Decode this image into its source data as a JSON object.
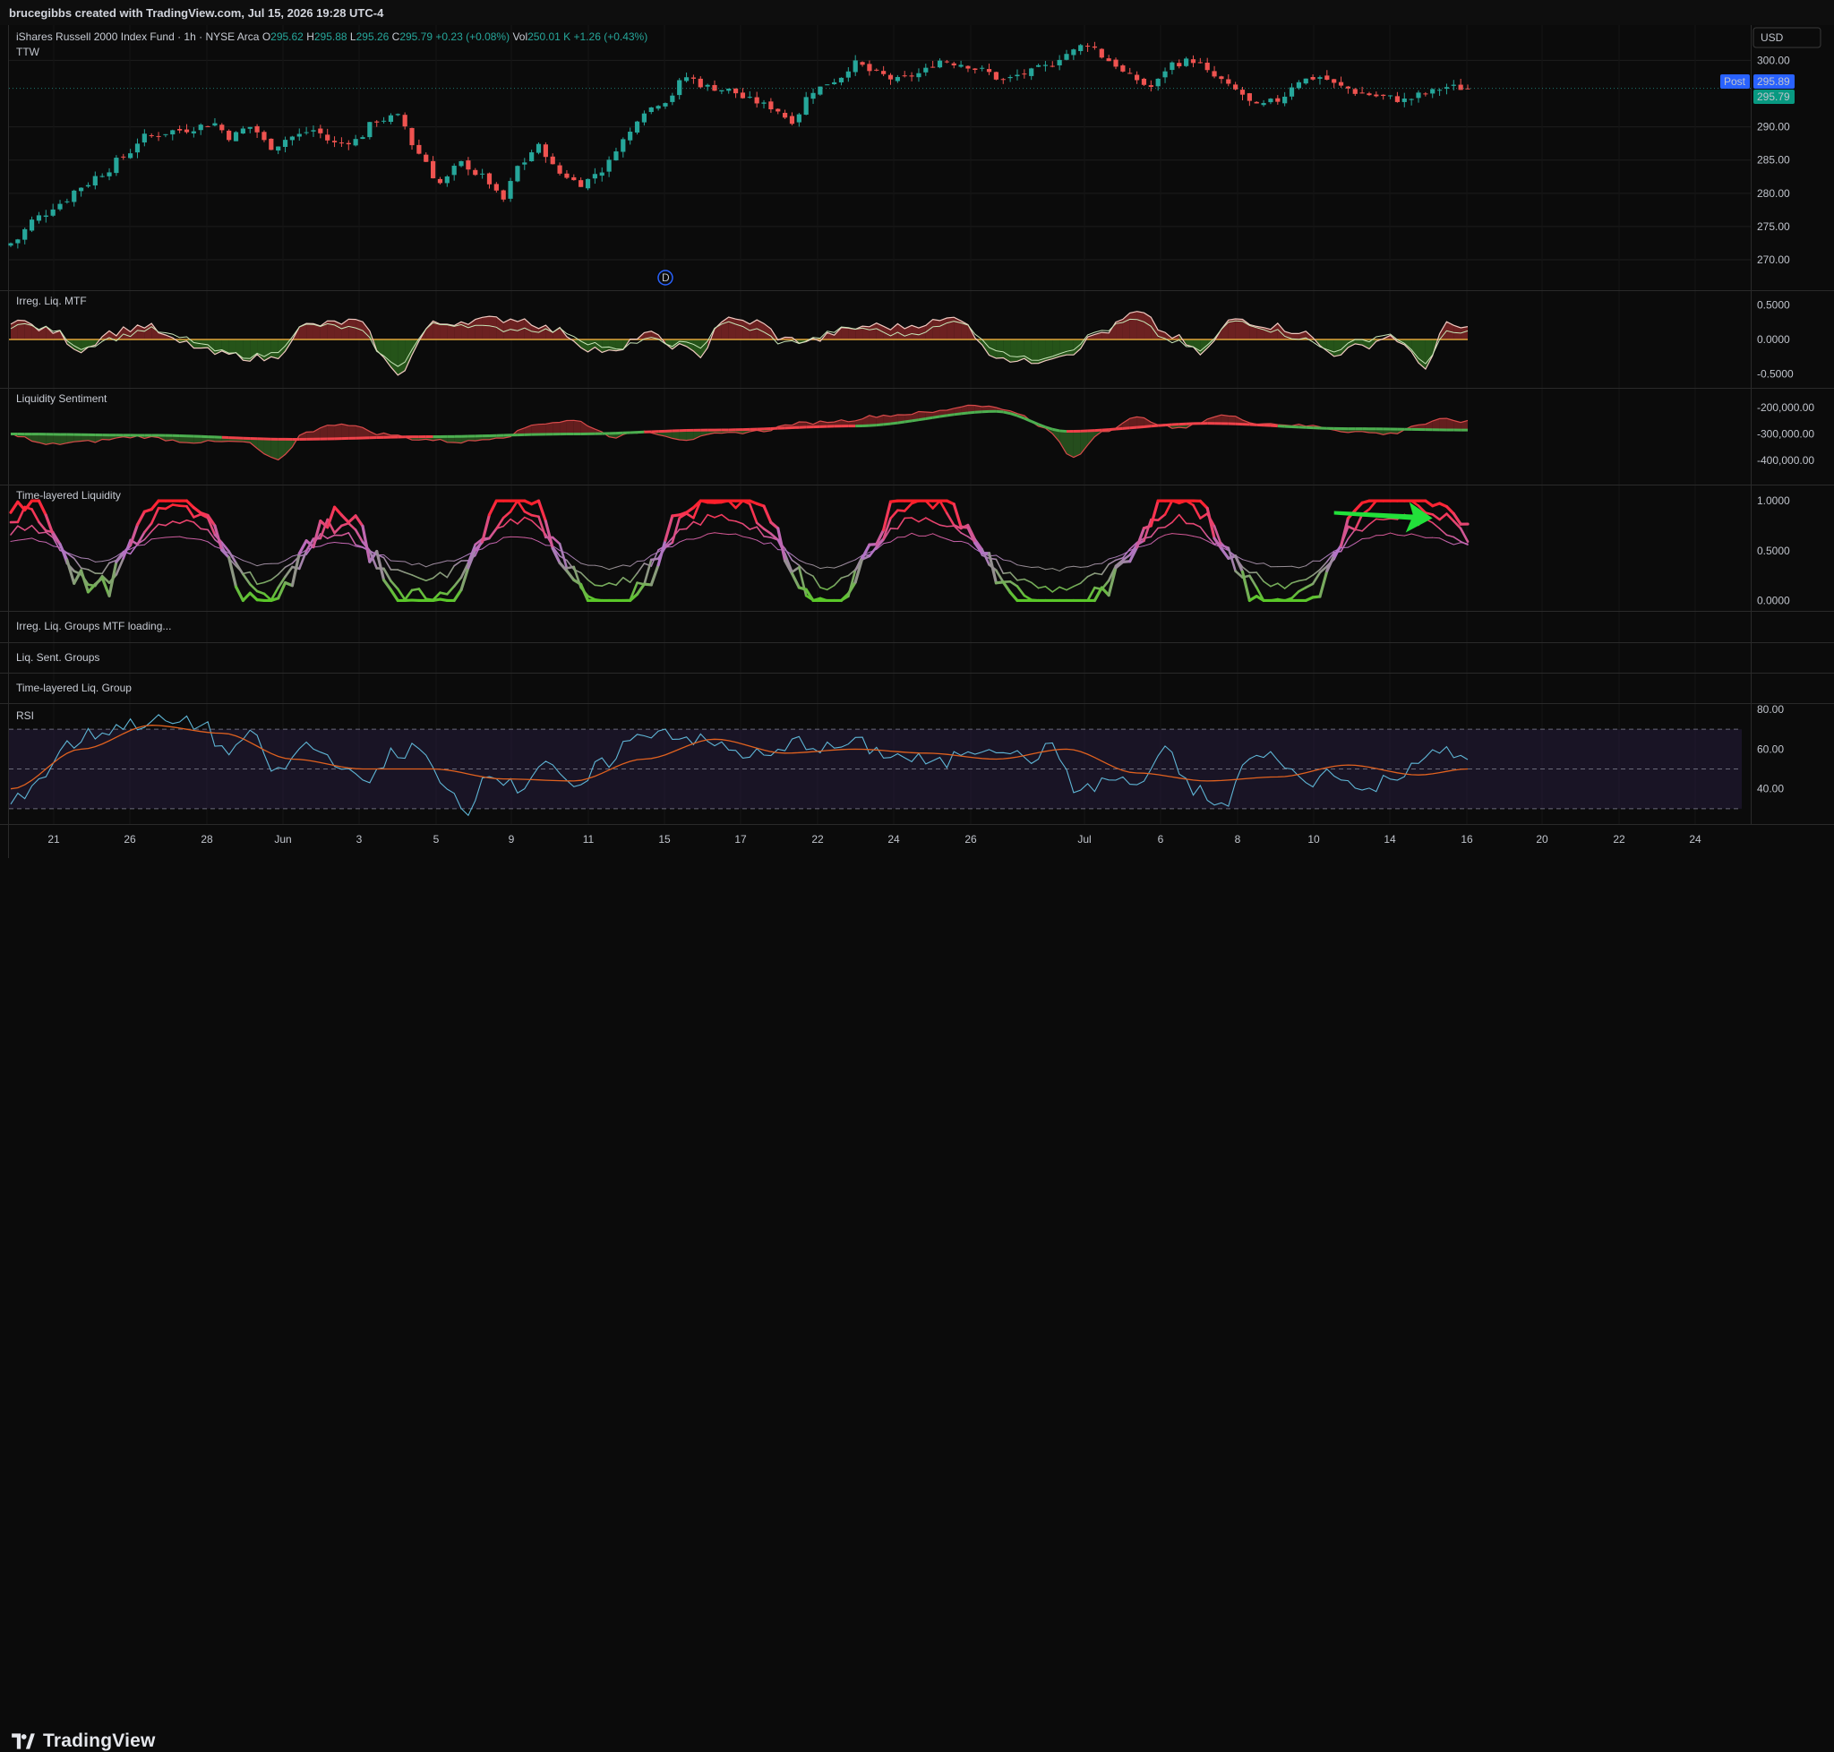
{
  "header": {
    "watermark": "brucegibbs created with TradingView.com, Jul 15, 2026 19:28 UTC-4"
  },
  "footer": {
    "brand": "TradingView"
  },
  "colors": {
    "up": "#26a69a",
    "down": "#ef5350",
    "bg": "#0b0b0b",
    "grid": "#1c1c1c",
    "post_badge": "#2962ff",
    "last_badge": "#089981",
    "rsi_line": "#5fb6d6",
    "rsi_ma": "#e0611f"
  },
  "chart_data": [
    {
      "type": "candlestick",
      "pane": "price",
      "symbol_title": "iShares Russell 2000 Index Fund · 1h · NYSE Arca",
      "symbol_sub": "TTW",
      "ohlc": {
        "O": "295.62",
        "H": "295.88",
        "L": "295.26",
        "C": "295.79",
        "change": "+0.23 (+0.08%)"
      },
      "volume": {
        "label": "Vol",
        "value": "250.01 K",
        "change": "+1.26 (+0.43%)"
      },
      "currency": "USD",
      "post_label": "Post",
      "post_price": "295.89",
      "last_price": "295.79",
      "yticks": [
        300,
        290,
        285,
        280,
        275,
        270
      ],
      "ytick_labels": [
        "300.00",
        "290.00",
        "285.00",
        "280.00",
        "275.00",
        "270.00"
      ],
      "ylim": [
        266.5,
        304.5
      ],
      "anchors": [
        [
          0,
          272.5
        ],
        [
          4,
          276.5
        ],
        [
          7,
          278.5
        ],
        [
          10,
          281
        ],
        [
          13,
          283
        ],
        [
          16,
          285.5
        ],
        [
          19,
          288.5
        ],
        [
          24,
          289.5
        ],
        [
          29,
          290.5
        ],
        [
          31,
          288.5
        ],
        [
          34,
          290
        ],
        [
          37,
          287
        ],
        [
          40,
          288.5
        ],
        [
          43,
          289.5
        ],
        [
          46,
          287.5
        ],
        [
          49,
          288
        ],
        [
          52,
          291
        ],
        [
          55,
          291.5
        ],
        [
          58,
          286
        ],
        [
          61,
          281.5
        ],
        [
          64,
          284.5
        ],
        [
          67,
          282.5
        ],
        [
          70,
          279
        ],
        [
          72,
          284
        ],
        [
          75,
          287
        ],
        [
          78,
          283
        ],
        [
          81,
          281.5
        ],
        [
          84,
          283.5
        ],
        [
          87,
          288
        ],
        [
          90,
          292.5
        ],
        [
          93,
          294
        ],
        [
          96,
          297.5
        ],
        [
          99,
          296
        ],
        [
          102,
          295.5
        ],
        [
          105,
          294
        ],
        [
          108,
          293
        ],
        [
          111,
          291
        ],
        [
          114,
          295.5
        ],
        [
          117,
          297
        ],
        [
          120,
          299.5
        ],
        [
          123,
          298
        ],
        [
          126,
          297
        ],
        [
          129,
          298
        ],
        [
          132,
          300
        ],
        [
          135,
          299.5
        ],
        [
          138,
          298.5
        ],
        [
          141,
          297
        ],
        [
          144,
          298
        ],
        [
          147,
          299
        ],
        [
          150,
          301
        ],
        [
          153,
          302.5
        ],
        [
          156,
          300
        ],
        [
          159,
          297.5
        ],
        [
          162,
          296
        ],
        [
          165,
          299.5
        ],
        [
          168,
          300
        ],
        [
          171,
          297.5
        ],
        [
          174,
          295.5
        ],
        [
          177,
          293
        ],
        [
          180,
          294
        ],
        [
          183,
          297
        ],
        [
          186,
          297.5
        ],
        [
          189,
          296
        ],
        [
          192,
          295
        ],
        [
          195,
          294.5
        ],
        [
          198,
          294
        ],
        [
          201,
          295
        ],
        [
          204,
          296
        ],
        [
          207,
          295.8
        ]
      ],
      "candle_count": 208,
      "event_marker": {
        "label": "D",
        "index": 93
      }
    },
    {
      "type": "area",
      "pane": "irregular_liquidity_mtf",
      "title": "Irreg. Liq. MTF",
      "ytick_labels": [
        "0.5000",
        "0.0000",
        "-0.5000"
      ],
      "yticks": [
        0.5,
        0.0,
        -0.5
      ],
      "ylim": [
        -0.62,
        0.62
      ],
      "anchors": [
        [
          0,
          0.28
        ],
        [
          6,
          0.12
        ],
        [
          10,
          -0.15
        ],
        [
          14,
          0.1
        ],
        [
          19,
          0.2
        ],
        [
          24,
          -0.05
        ],
        [
          30,
          -0.22
        ],
        [
          37,
          -0.28
        ],
        [
          42,
          0.2
        ],
        [
          49,
          0.26
        ],
        [
          55,
          -0.48
        ],
        [
          60,
          0.22
        ],
        [
          66,
          0.28
        ],
        [
          72,
          0.3
        ],
        [
          78,
          0.12
        ],
        [
          82,
          -0.12
        ],
        [
          86,
          -0.2
        ],
        [
          90,
          0.1
        ],
        [
          94,
          -0.08
        ],
        [
          98,
          -0.22
        ],
        [
          101,
          0.28
        ],
        [
          106,
          0.25
        ],
        [
          110,
          0.0
        ],
        [
          114,
          -0.02
        ],
        [
          118,
          0.12
        ],
        [
          122,
          0.2
        ],
        [
          126,
          0.18
        ],
        [
          131,
          0.25
        ],
        [
          135,
          0.32
        ],
        [
          139,
          -0.2
        ],
        [
          144,
          -0.33
        ],
        [
          150,
          -0.2
        ],
        [
          155,
          0.1
        ],
        [
          160,
          0.38
        ],
        [
          165,
          0.05
        ],
        [
          169,
          -0.2
        ],
        [
          174,
          0.3
        ],
        [
          179,
          0.2
        ],
        [
          183,
          0.12
        ],
        [
          188,
          -0.2
        ],
        [
          192,
          -0.1
        ],
        [
          196,
          0.05
        ],
        [
          201,
          -0.38
        ],
        [
          204,
          0.2
        ],
        [
          207,
          0.16
        ]
      ]
    },
    {
      "type": "area",
      "pane": "liquidity_sentiment",
      "title": "Liquidity Sentiment",
      "ytick_labels": [
        "-200,000.00",
        "-300,000.00",
        "-400,000.00"
      ],
      "yticks": [
        -200000,
        -300000,
        -400000
      ],
      "ylim": [
        -470000,
        -150000
      ],
      "anchors": [
        [
          0,
          -300000
        ],
        [
          5,
          -340000
        ],
        [
          10,
          -330000
        ],
        [
          18,
          -310000
        ],
        [
          26,
          -330000
        ],
        [
          33,
          -330000
        ],
        [
          38,
          -400000
        ],
        [
          42,
          -290000
        ],
        [
          47,
          -260000
        ],
        [
          53,
          -300000
        ],
        [
          58,
          -320000
        ],
        [
          64,
          -330000
        ],
        [
          70,
          -310000
        ],
        [
          75,
          -260000
        ],
        [
          80,
          -250000
        ],
        [
          86,
          -310000
        ],
        [
          90,
          -290000
        ],
        [
          96,
          -320000
        ],
        [
          101,
          -300000
        ],
        [
          106,
          -290000
        ],
        [
          112,
          -260000
        ],
        [
          118,
          -250000
        ],
        [
          124,
          -230000
        ],
        [
          130,
          -220000
        ],
        [
          137,
          -190000
        ],
        [
          142,
          -210000
        ],
        [
          147,
          -280000
        ],
        [
          151,
          -390000
        ],
        [
          155,
          -290000
        ],
        [
          160,
          -240000
        ],
        [
          166,
          -280000
        ],
        [
          172,
          -230000
        ],
        [
          178,
          -260000
        ],
        [
          185,
          -270000
        ],
        [
          190,
          -290000
        ],
        [
          196,
          -300000
        ],
        [
          200,
          -265000
        ],
        [
          204,
          -245000
        ],
        [
          207,
          -255000
        ]
      ],
      "baseline_anchors": [
        [
          0,
          -300000
        ],
        [
          20,
          -305000
        ],
        [
          40,
          -320000
        ],
        [
          60,
          -310000
        ],
        [
          80,
          -300000
        ],
        [
          100,
          -285000
        ],
        [
          120,
          -270000
        ],
        [
          140,
          -215000
        ],
        [
          150,
          -290000
        ],
        [
          170,
          -260000
        ],
        [
          190,
          -280000
        ],
        [
          207,
          -285000
        ]
      ]
    },
    {
      "type": "line",
      "pane": "time_layered_liquidity",
      "title": "Time-layered Liquidity",
      "ytick_labels": [
        "1.0000",
        "0.5000",
        "0.0000"
      ],
      "yticks": [
        1.0,
        0.5,
        0.0
      ],
      "ylim": [
        -0.05,
        1.1
      ],
      "series_count": 4,
      "arrow_annotation": {
        "from_index": 188,
        "to_index": 202,
        "value": 0.88
      }
    },
    {
      "type": "pane",
      "pane": "collapsed",
      "titles": [
        "Irreg. Liq. Groups MTF loading...",
        "Liq. Sent. Groups",
        "Time-layered Liq. Group"
      ]
    },
    {
      "type": "line",
      "pane": "rsi",
      "title": "RSI",
      "ytick_labels": [
        "80.00",
        "60.00",
        "40.00"
      ],
      "yticks": [
        80,
        60,
        40
      ],
      "ylim": [
        25,
        80
      ],
      "band": [
        30,
        70
      ],
      "midline": 50,
      "anchors": [
        [
          0,
          32
        ],
        [
          4,
          45
        ],
        [
          8,
          62
        ],
        [
          12,
          68
        ],
        [
          16,
          72
        ],
        [
          20,
          74
        ],
        [
          24,
          73
        ],
        [
          28,
          72
        ],
        [
          30,
          58
        ],
        [
          34,
          66
        ],
        [
          38,
          48
        ],
        [
          42,
          62
        ],
        [
          46,
          55
        ],
        [
          50,
          42
        ],
        [
          54,
          57
        ],
        [
          58,
          60
        ],
        [
          62,
          38
        ],
        [
          65,
          30
        ],
        [
          68,
          50
        ],
        [
          72,
          40
        ],
        [
          76,
          55
        ],
        [
          80,
          38
        ],
        [
          84,
          52
        ],
        [
          88,
          64
        ],
        [
          92,
          70
        ],
        [
          96,
          66
        ],
        [
          100,
          62
        ],
        [
          104,
          58
        ],
        [
          108,
          56
        ],
        [
          112,
          64
        ],
        [
          116,
          60
        ],
        [
          120,
          63
        ],
        [
          124,
          58
        ],
        [
          128,
          55
        ],
        [
          132,
          52
        ],
        [
          136,
          60
        ],
        [
          140,
          62
        ],
        [
          144,
          55
        ],
        [
          148,
          60
        ],
        [
          152,
          38
        ],
        [
          156,
          45
        ],
        [
          160,
          42
        ],
        [
          164,
          58
        ],
        [
          168,
          40
        ],
        [
          172,
          30
        ],
        [
          176,
          55
        ],
        [
          180,
          56
        ],
        [
          184,
          42
        ],
        [
          188,
          50
        ],
        [
          192,
          38
        ],
        [
          196,
          45
        ],
        [
          200,
          55
        ],
        [
          204,
          58
        ],
        [
          207,
          55
        ]
      ],
      "ma_anchors": [
        [
          0,
          40
        ],
        [
          10,
          60
        ],
        [
          20,
          72
        ],
        [
          30,
          68
        ],
        [
          40,
          55
        ],
        [
          50,
          50
        ],
        [
          60,
          50
        ],
        [
          70,
          45
        ],
        [
          80,
          44
        ],
        [
          90,
          55
        ],
        [
          100,
          65
        ],
        [
          110,
          58
        ],
        [
          120,
          60
        ],
        [
          130,
          58
        ],
        [
          140,
          55
        ],
        [
          150,
          60
        ],
        [
          160,
          48
        ],
        [
          170,
          44
        ],
        [
          180,
          46
        ],
        [
          190,
          52
        ],
        [
          200,
          47
        ],
        [
          207,
          50
        ]
      ]
    },
    {
      "type": "axis",
      "pane": "time",
      "x_labels": [
        "21",
        "26",
        "28",
        "Jun",
        "3",
        "5",
        "9",
        "11",
        "15",
        "17",
        "22",
        "24",
        "26",
        "Jul",
        "6",
        "8",
        "10",
        "14",
        "16",
        "20",
        "22",
        "24"
      ]
    }
  ]
}
